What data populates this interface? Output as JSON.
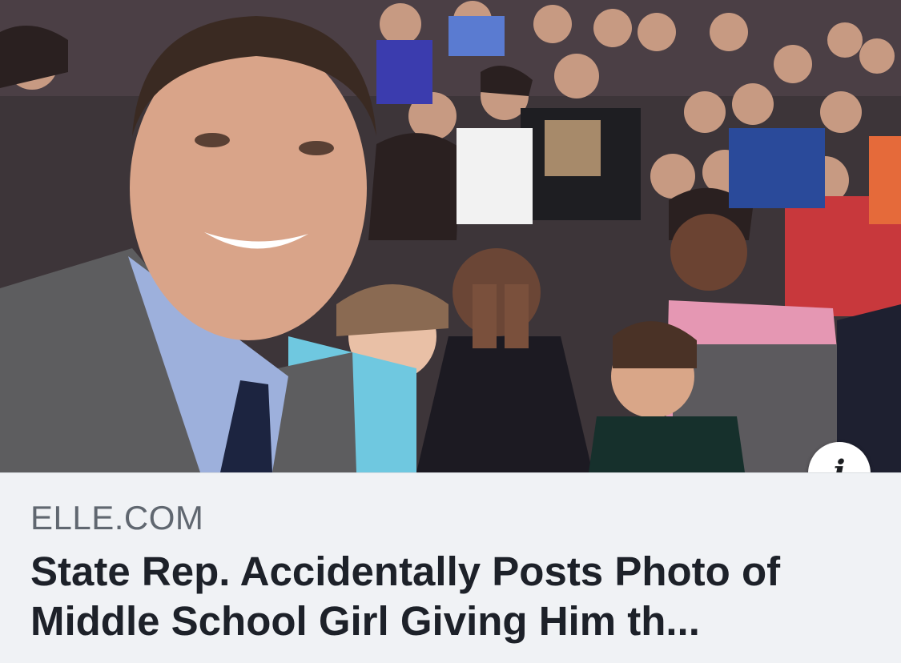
{
  "link_preview": {
    "info_icon": "info-icon",
    "photo_icon": "photo-thumbnail",
    "domain": "ELLE.COM",
    "headline": "State Rep. Accidentally Posts Photo of Middle School Girl Giving Him th..."
  },
  "colors": {
    "caption_bg": "#f0f2f5",
    "domain_text": "#606770",
    "headline_text": "#1d2129",
    "info_button_bg": "#ffffff"
  }
}
